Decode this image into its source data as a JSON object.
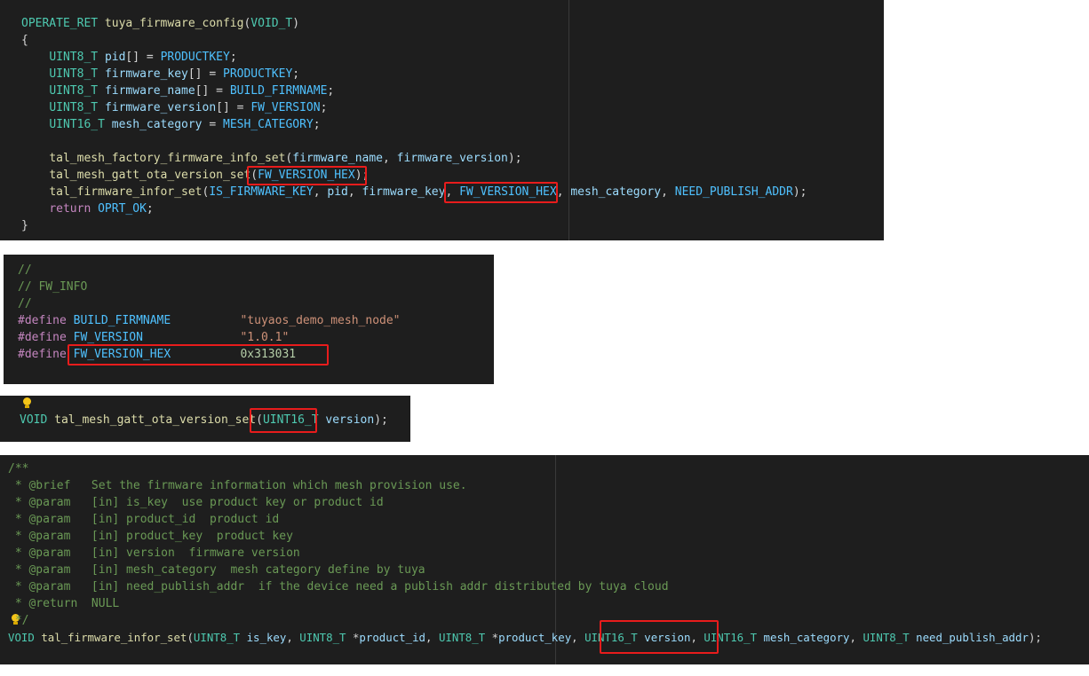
{
  "panel1": {
    "lines": [
      "OPERATE_RET tuya_firmware_config(VOID_T)",
      "{",
      "    UINT8_T pid[] = PRODUCTKEY;",
      "    UINT8_T firmware_key[] = PRODUCTKEY;",
      "    UINT8_T firmware_name[] = BUILD_FIRMNAME;",
      "    UINT8_T firmware_version[] = FW_VERSION;",
      "    UINT16_T mesh_category = MESH_CATEGORY;",
      "",
      "    tal_mesh_factory_firmware_info_set(firmware_name, firmware_version);",
      "    tal_mesh_gatt_ota_version_set(FW_VERSION_HEX);",
      "    tal_firmware_infor_set(IS_FIRMWARE_KEY, pid, firmware_key, FW_VERSION_HEX, mesh_category, NEED_PUBLISH_ADDR);",
      "    return OPRT_OK;",
      "}"
    ]
  },
  "panel2": {
    "lines": [
      "//",
      "// FW_INFO",
      "//",
      "#define BUILD_FIRMNAME          \"tuyaos_demo_mesh_node\"",
      "#define FW_VERSION              \"1.0.1\"",
      "#define FW_VERSION_HEX          0x313031"
    ]
  },
  "panel3": {
    "line": "VOID tal_mesh_gatt_ota_version_set(UINT16_T version);"
  },
  "panel4": {
    "lines": [
      "/**",
      " * @brief   Set the firmware information which mesh provision use.",
      " * @param   [in] is_key  use product key or product id",
      " * @param   [in] product_id  product id",
      " * @param   [in] product_key  product key",
      " * @param   [in] version  firmware version",
      " * @param   [in] mesh_category  mesh category define by tuya",
      " * @param   [in] need_publish_addr  if the device need a publish addr distributed by tuya cloud",
      " * @return  NULL",
      " */",
      "VOID tal_firmware_infor_set(UINT8_T is_key, UINT8_T *product_id, UINT8_T *product_key, UINT16_T version, UINT16_T mesh_category, UINT8_T need_publish_addr);"
    ]
  },
  "icons": [
    "lightbulb-icon"
  ],
  "colors": {
    "editor_bg": "#1e1e1e",
    "highlight_box": "#e81c1c",
    "keyword": "#569cd6",
    "type": "#4ec9b0",
    "function": "#dcdcaa",
    "variable": "#9cdcfe",
    "string": "#ce9178",
    "comment": "#6a9955",
    "macro": "#c586c0"
  }
}
